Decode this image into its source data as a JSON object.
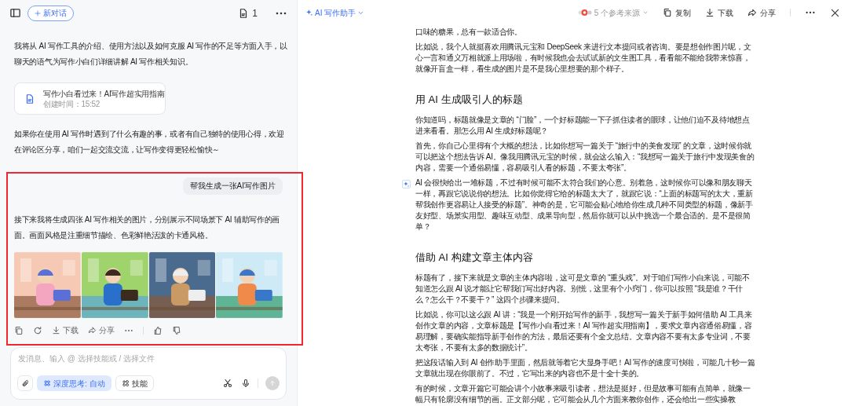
{
  "chat": {
    "new_chat": "新对话",
    "doc_count": "1",
    "intro": "我将从 AI 写作工具的介绍、使用方法以及如何克服 AI 写作的不足等方面入手，以聊天的语气为写作小白们详细讲解 AI 写作相关知识。",
    "doc_card": {
      "title": "写作小白看过来！AI写作超实用指南",
      "meta": "创建时间：15:52"
    },
    "outro": "如果你在使用 AI 写作时遇到了什么有趣的事，或者有自己独特的使用心得，欢迎在评论区分享，咱们一起交流交流，让写作变得更轻松愉快～",
    "user_message": "帮我生成一张AI写作图片",
    "reply": "接下来我将生成四张 AI 写作相关的图片，分别展示不同场景下 AI 辅助写作的画面。画面风格是注重细节描绘、色彩鲜艳活泼的卡通风格。",
    "images": [
      {
        "kind": "picture"
      },
      {
        "kind": "picture"
      },
      {
        "kind": "picture"
      },
      {
        "kind": "picture"
      }
    ],
    "actions": [
      "下载",
      "分享"
    ],
    "input": {
      "placeholder": "发消息、输入 @ 选择技能或 / 选择文件",
      "deep_think": "深度思考: 自动",
      "skills": "技能"
    }
  },
  "doc": {
    "assistant": "AI 写作助手",
    "sources": "5 个参考来源",
    "toolbar": [
      "复制",
      "下载",
      "分享"
    ],
    "content": [
      {
        "kind": "p",
        "text": "口味的糖果，总有一款适合你。"
      },
      {
        "kind": "p",
        "text": "比如说，我个人就挺喜欢用腾讯元宝和 DeepSeek 来进行文本提问或者咨询。要是想创作图片呢，文心一言和通义万相就派上用场啦，有时候我也会去试试新的文生图工具，看看能不能给我带来惊喜，就像开盲盒一样，看生成的图片是不是我心里想要的那个样子。"
      },
      {
        "kind": "h",
        "text": "用 AI 生成吸引人的标题"
      },
      {
        "kind": "p",
        "text": "你知道吗，标题就像是文章的 “门脸”，一个好标题能一下子抓住读者的眼球，让他们迫不及待地想点进来看看。那怎么用 AI 生成好标题呢？"
      },
      {
        "kind": "p",
        "text": "首先，你自己心里得有个大概的想法，比如你想写一篇关于 “旅行中的美食发现” 的文章，这时候你就可以把这个想法告诉 AI。像我用腾讯元宝的时候，就会这么输入：“我想写一篇关于旅行中发现美食的内容，需要一个通俗易懂，容易吸引人看的标题，不要太夸张”。"
      },
      {
        "kind": "p",
        "marker": true,
        "text": "AI 会很快给出一堆标题，不过有时候可能不太符合我们的心意。别着急，这时候你可以像和朋友聊天一样，再跟它说说你的想法。比如你觉得它给的标题太大了，就跟它说：“上面的标题写的太大，重新帮我创作更容易让人接受的标题”。神奇的是，它可能会贴心地给你生成几种不同类型的标题，像新手友好型、场景实用型、趣味互动型、成果导向型，然后你就可以从中挑选一个最合适的。是不是很简单？"
      },
      {
        "kind": "h",
        "text": "借助 AI 构建文章主体内容"
      },
      {
        "kind": "p",
        "text": "标题有了，接下来就是文章的主体内容啦，这可是文章的 “重头戏”。对于咱们写作小白来说，可能不知道怎么跟 AI 说才能让它帮我们写出好内容。别慌，这里有个小窍门，你可以按照 “我是谁？干什么？怎么干？不要干？” 这四个步骤来提问。"
      },
      {
        "kind": "p",
        "text": "比如说，你可以这么跟 AI 讲：“我是一个刚开始写作的新手，我想写一篇关于新手如何借助 AI 工具来创作文章的内容，文章标题是【写作小白看过来！AI 写作超实用指南】，要求文章内容通俗易懂，容易理解，要确实能指导新手创作的方法，最后还要有个全文总结。文章内容不要有太多专业词，不要太夸张，不要有太多的数据统计”。"
      },
      {
        "kind": "p",
        "text": "把这段话输入到 AI 创作助手里面，然后就等着它大显身手吧！AI 写作的速度可快啦，可能几十秒一篇文章就出现在你眼前了。不过，它写出来的内容也不是十全十美的。"
      },
      {
        "kind": "p",
        "text": "有的时候，文章开篇它可能会讲个小故事来吸引读者，想法是挺好，但是故事可能有点简单，就像一幅只有轮廓没有细节的画。正文部分呢，它可能会从几个方面来教你创作，还会给出一些实操教"
      }
    ]
  }
}
